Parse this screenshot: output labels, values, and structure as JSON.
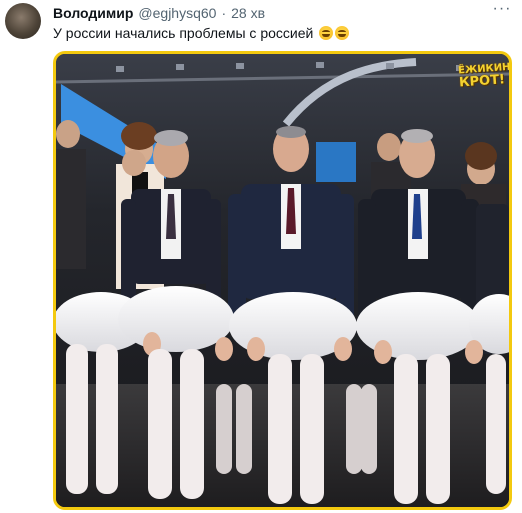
{
  "tweet": {
    "author_name": "Володимир",
    "author_handle": "@egjhysq60",
    "separator": "·",
    "timestamp": "28 хв",
    "more_label": "···",
    "text": "У россии начались проблемы с россией",
    "emojis": [
      "grinning-face-with-smiling-eyes",
      "grinning-face-with-smiling-eyes"
    ]
  },
  "media": {
    "watermark": {
      "top": "ЁЖИКИН",
      "bottom": "КРОТ!"
    },
    "border_color": "#f3c90f"
  },
  "colors": {
    "text": "#0f1419",
    "secondary": "#536471",
    "frame": "#f3c90f"
  }
}
